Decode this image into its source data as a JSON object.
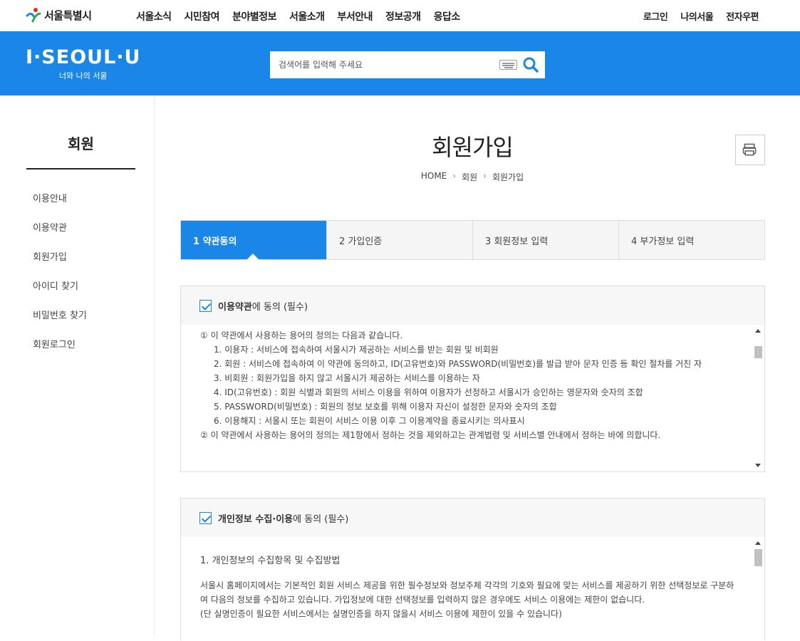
{
  "header": {
    "logo_text": "서울특별시",
    "nav": [
      "서울소식",
      "시민참여",
      "분야별정보",
      "서울소개",
      "부서안내",
      "정보공개",
      "응답소"
    ],
    "util": [
      "로그인",
      "나의서울",
      "전자우편"
    ]
  },
  "banner": {
    "brand": "I·SEOUL·U",
    "brand_sub": "너와 나의 서울",
    "search_placeholder": "검색어를 입력해 주세요"
  },
  "sidebar": {
    "title": "회원",
    "items": [
      "이용안내",
      "이용약관",
      "회원가입",
      "아이디 찾기",
      "비밀번호 찾기",
      "회원로그인"
    ]
  },
  "page": {
    "title": "회원가입",
    "breadcrumb": [
      "HOME",
      "회원",
      "회원가입"
    ]
  },
  "steps": [
    "1 약관동의",
    "2 가입인증",
    "3 회원정보 입력",
    "4 부가정보 입력"
  ],
  "terms_agree": {
    "label_bold": "이용약관",
    "label_rest": "에 동의 (필수)",
    "lines": [
      "① 이 약관에서 사용하는 용어의 정의는 다음과 같습니다.",
      "1. 이용자 : 서비스에 접속하여 서울시가 제공하는 서비스를 받는 회원 및 비회원",
      "2. 회원 : 서비스에 접속하여 이 약관에 동의하고, ID(고유번호)와 PASSWORD(비밀번호)를 발급 받아 문자 인증 등 확인 절차를 거친 자",
      "3. 비회원 : 회원가입을 하지 않고 서울시가 제공하는 서비스를 이용하는 자",
      "4. ID(고유번호) : 회원 식별과 회원의 서비스 이용을 위하여 이용자가 선정하고 서울시가 승인하는 영문자와 숫자의 조합",
      "5. PASSWORD(비밀번호) : 회원의 정보 보호를 위해 이용자 자신이 설정한 문자와 숫자의 조합",
      "6. 이용해지 : 서울시 또는 회원이 서비스 이용 이후 그 이용계약을 종료시키는 의사표시",
      "② 이 약관에서 사용하는 용어의 정의는 제1항에서 정하는 것을 제외하고는 관계법령 및 서비스별 안내에서 정하는 바에 의합니다."
    ]
  },
  "privacy_agree": {
    "label_bold": "개인정보 수집·이용",
    "label_rest": "에 동의 (필수)",
    "heading": "1. 개인정보의 수집항목 및 수집방법",
    "paragraph": "서울시 홈페이지에서는 기본적인 회원 서비스 제공을 위한 필수정보와 정보주체 각각의 기호와 필요에 맞는 서비스를 제공하기 위한 선택정보로 구분하여 다음의 정보를 수집하고 있습니다. 가입정보에 대한 선택정보를 입력하지 않은 경우에도 서비스 이용에는 제한이 없습니다.",
    "note": "(단 실명인증이 필요한 서비스에서는 실명인증을 하지 않을시 서비스 이용에 제한이 있을 수 있습니다)"
  }
}
